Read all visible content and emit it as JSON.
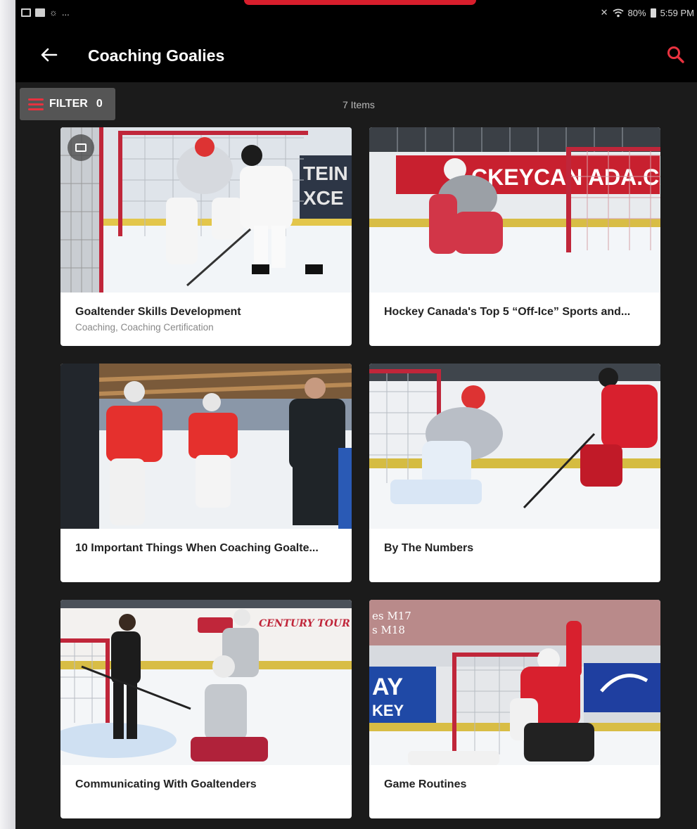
{
  "status_bar": {
    "left_icons": [
      "gallery-icon",
      "picture-icon",
      "sun-icon"
    ],
    "left_more": "...",
    "battery": "80%",
    "time": "5:59 PM"
  },
  "app_bar": {
    "title": "Coaching Goalies"
  },
  "filter": {
    "label": "FILTER",
    "count": "0"
  },
  "items_count": "7 Items",
  "cards": [
    {
      "title": "Goaltender Skills Development",
      "subtitle": "Coaching, Coaching Certification",
      "has_gallery": true
    },
    {
      "title": "Hockey Canada's Top 5 “Off-Ice” Sports and...",
      "subtitle": ""
    },
    {
      "title": "10 Important Things When Coaching Goalte...",
      "subtitle": ""
    },
    {
      "title": "By The Numbers",
      "subtitle": ""
    },
    {
      "title": "Communicating With Goaltenders",
      "subtitle": ""
    },
    {
      "title": "Game Routines",
      "subtitle": ""
    }
  ],
  "image_text": {
    "card1_banner_a": "TEIN",
    "card1_banner_b": "XCE",
    "card2_banner": "CKEYCAN ADA.CA",
    "card5_banner": "CENTURY TOUR",
    "card6_a": "es M17",
    "card6_b": "s M18",
    "card6_c": "AY",
    "card6_d": "KEY"
  },
  "colors": {
    "accent": "#e8323f",
    "background": "#1b1b1b",
    "app_bar": "#000000"
  }
}
